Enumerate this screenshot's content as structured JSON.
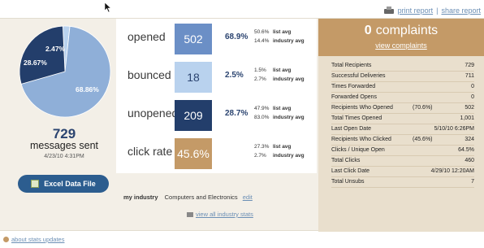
{
  "top_links": {
    "print": "print report",
    "separator": "|",
    "share": "share report"
  },
  "pie": {
    "slices": [
      {
        "name": "opened",
        "value": 68.86,
        "label": "68.86%",
        "color": "#8fafd8"
      },
      {
        "name": "unopened",
        "value": 28.67,
        "label": "28.67%",
        "color": "#233e6b"
      },
      {
        "name": "bounced",
        "value": 2.47,
        "label": "2.47%",
        "color": "#b9d2ee"
      }
    ]
  },
  "sent": {
    "count": "729",
    "label": "messages sent",
    "date": "4/23/10 4:31PM"
  },
  "excel_button": "Excel Data File",
  "stats": [
    {
      "key": "opened",
      "label": "opened",
      "value": "502",
      "pct": "68.9%",
      "box_color": "#6b8fc6",
      "text_color": "#ffffff",
      "list_avg": "50.6%",
      "industry_avg": "14.4%"
    },
    {
      "key": "bounced",
      "label": "bounced",
      "value": "18",
      "pct": "2.5%",
      "box_color": "#b9d2ee",
      "text_color": "#2b4470",
      "list_avg": "1.5%",
      "industry_avg": "2.7%"
    },
    {
      "key": "unopened",
      "label": "unopened",
      "value": "209",
      "pct": "28.7%",
      "box_color": "#233e6b",
      "text_color": "#ffffff",
      "list_avg": "47.9%",
      "industry_avg": "83.0%"
    },
    {
      "key": "click-rate",
      "label": "click rate",
      "value": "45.6%",
      "pct": "",
      "box_color": "#c49a67",
      "text_color": "#ffffff",
      "list_avg": "27.3%",
      "industry_avg": "2.7%"
    }
  ],
  "avg_labels": {
    "list": "list avg",
    "industry": "industry avg"
  },
  "industry": {
    "label": "my industry",
    "value": "Computers and Electronics",
    "edit": "edit",
    "view_all": "view all industry stats"
  },
  "complaints": {
    "count": "0",
    "title": "complaints",
    "link": "view complaints",
    "rows": [
      {
        "label": "Total Recipients",
        "pct": "",
        "value": "729"
      },
      {
        "label": "Successful Deliveries",
        "pct": "",
        "value": "711"
      },
      {
        "label": "Times Forwarded",
        "pct": "",
        "value": "0"
      },
      {
        "label": "Forwarded Opens",
        "pct": "",
        "value": "0"
      },
      {
        "label": "Recipients Who Opened",
        "pct": "(70.6%)",
        "value": "502"
      },
      {
        "label": "Total Times Opened",
        "pct": "",
        "value": "1,001"
      },
      {
        "label": "Last Open Date",
        "pct": "",
        "value": "5/10/10 6:26PM"
      },
      {
        "label": "Recipients Who Clicked",
        "pct": "(45.6%)",
        "value": "324"
      },
      {
        "label": "Clicks / Unique Open",
        "pct": "",
        "value": "64.5%"
      },
      {
        "label": "Total Clicks",
        "pct": "",
        "value": "460"
      },
      {
        "label": "Last Click Date",
        "pct": "",
        "value": "4/29/10 12:20AM"
      },
      {
        "label": "Total Unsubs",
        "pct": "",
        "value": "7"
      }
    ]
  },
  "about_link": "about stats updates"
}
